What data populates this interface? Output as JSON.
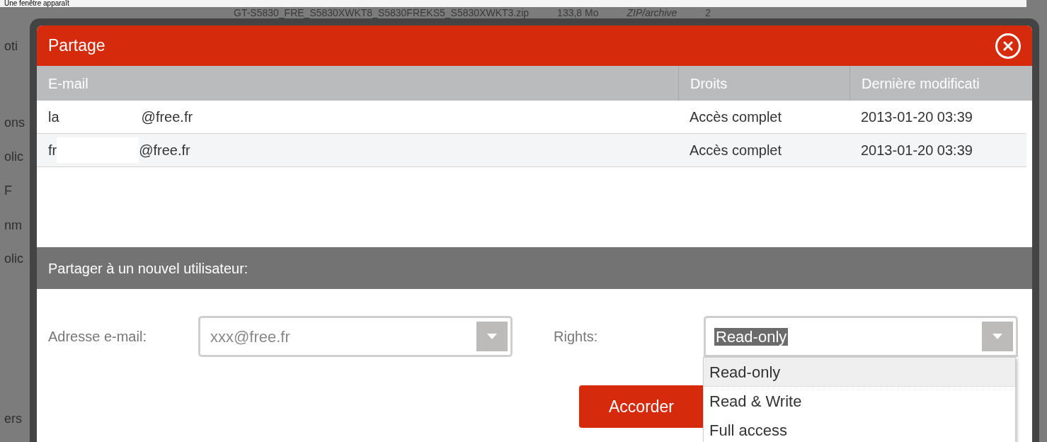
{
  "page": {
    "caption": "Une fenêtre apparaît",
    "file_row": [
      "GT-S5830_FRE_S5830XWKT8_S5830FREKS5_S5830XWKT3.zip",
      "133,8 Mo",
      "ZIP/archive",
      "2"
    ],
    "side_fragments": [
      "oti",
      "ons",
      "olic",
      "F",
      "nm",
      "olic",
      "ers"
    ]
  },
  "dialog": {
    "title": "Partage",
    "table": {
      "columns": [
        "E-mail",
        "Droits",
        "Dernière modificati"
      ],
      "rows": [
        {
          "email_start": "la",
          "email_end": "@free.fr",
          "rights": "Accès complet",
          "modified": "2013-01-20 03:39"
        },
        {
          "email_start": "fr",
          "email_end": "@free.fr",
          "rights": "Accès complet",
          "modified": "2013-01-20 03:39"
        }
      ]
    },
    "section_title": "Partager à un nouvel utilisateur:",
    "email_label": "Adresse e-mail:",
    "email_field": {
      "placeholder": "xxx@free.fr"
    },
    "rights_label": "Rights:",
    "rights_select": {
      "value": "Read-only",
      "expanded": true,
      "options": [
        {
          "label": "Read-only",
          "selected": true
        },
        {
          "label": "Read & Write",
          "selected": false
        },
        {
          "label": "Full access",
          "selected": false
        }
      ]
    },
    "submit_button": "Accorder"
  }
}
